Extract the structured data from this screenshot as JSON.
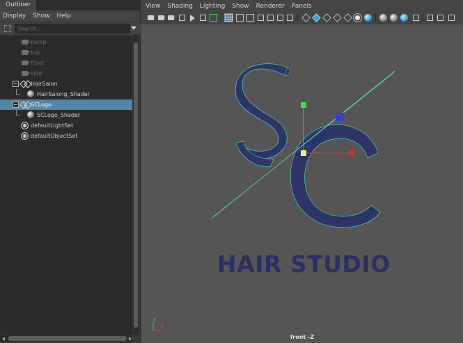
{
  "outliner": {
    "tab_label": "Outliner",
    "menu": [
      "Display",
      "Show",
      "Help"
    ],
    "search_placeholder": "Search...",
    "items": [
      {
        "label": "persp",
        "icon": "camera-icon",
        "dim": true
      },
      {
        "label": "top",
        "icon": "camera-icon",
        "dim": true
      },
      {
        "label": "front",
        "icon": "camera-icon",
        "dim": true
      },
      {
        "label": "side",
        "icon": "camera-icon",
        "dim": true
      },
      {
        "label": "HairSalon",
        "icon": "transform-node-icon",
        "dim": false
      },
      {
        "label": "HairSalong_Shader",
        "icon": "shader-sphere-icon",
        "dim": false
      },
      {
        "label": "SCLogo",
        "icon": "transform-node-icon",
        "dim": false,
        "selected": true
      },
      {
        "label": "SCLogo_Shader",
        "icon": "shader-sphere-icon",
        "dim": false
      },
      {
        "label": "defaultLightSet",
        "icon": "set-icon",
        "dim": false
      },
      {
        "label": "defaultObjectSet",
        "icon": "set-icon",
        "dim": false
      }
    ],
    "selection_color": "#5285a6"
  },
  "viewport": {
    "menu": [
      "View",
      "Shading",
      "Lighting",
      "Show",
      "Renderer",
      "Panels"
    ],
    "camera_label": "front -Z",
    "logo_text": "HAIR STUDIO",
    "logo_letters": "SC",
    "logo_color": "#2a3062",
    "wireframe_color": "#4fd6b0",
    "background_color": "#555555",
    "axis_labels": {
      "x": "x",
      "y": "y"
    }
  }
}
